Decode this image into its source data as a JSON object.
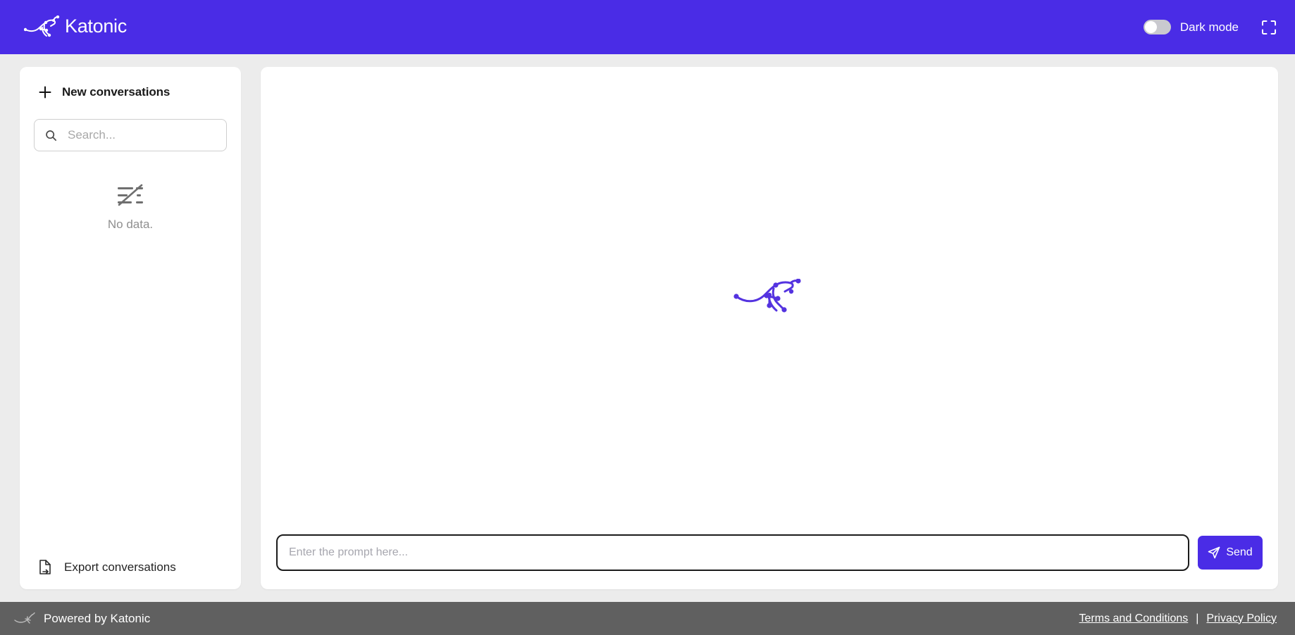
{
  "header": {
    "brand_name": "Katonic",
    "logo_icon": "kangaroo-logo",
    "dark_mode_label": "Dark mode",
    "dark_mode_enabled": false,
    "fullscreen_icon": "fullscreen-expand-icon",
    "accent_color": "#4a2ce6"
  },
  "sidebar": {
    "new_conversation_label": "New conversations",
    "new_conversation_icon": "plus-icon",
    "search": {
      "icon": "search-icon",
      "placeholder": "Search...",
      "value": ""
    },
    "empty_state": {
      "icon": "no-data-lines-slash-icon",
      "text": "No data."
    },
    "export": {
      "icon": "file-export-icon",
      "label": "Export conversations"
    }
  },
  "main": {
    "watermark_icon": "kangaroo-watermark",
    "watermark_color": "#5433e0",
    "composer": {
      "placeholder": "Enter the prompt here...",
      "value": "",
      "send_label": "Send",
      "send_icon": "send-paper-plane-icon"
    }
  },
  "footer": {
    "logo_icon": "kangaroo-logo-small",
    "powered_by": "Powered by Katonic",
    "terms_label": "Terms and Conditions",
    "separator": "|",
    "privacy_label": "Privacy Policy",
    "background_color": "#606060"
  }
}
